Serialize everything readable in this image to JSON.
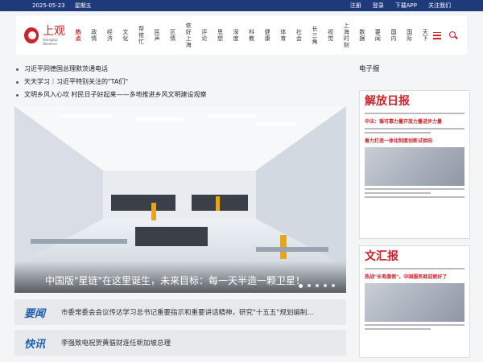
{
  "topbar": {
    "date": "2025-05-23",
    "weekday": "星期五",
    "links": [
      "注册",
      "登录",
      "下载APP",
      "关注我们"
    ]
  },
  "logo": {
    "cn": "上观",
    "en": "Shanghai Observer"
  },
  "nav": [
    "热点",
    "政情",
    "经济",
    "文化",
    "帮侬忙",
    "民声",
    "区情",
    "侬好上海",
    "评论",
    "思想",
    "深度",
    "科教",
    "健康",
    "体育",
    "社会",
    "长三角",
    "视觉",
    "上海时刻",
    "数据",
    "要闻",
    "国内",
    "国际",
    "天下"
  ],
  "news": [
    "习近平同德国总理默茨通电话",
    "天天学习｜习近平特别关注的\"TA们\"",
    "文明乡风入心坎 村民日子好起来——多地推进乡风文明建设观察"
  ],
  "hero": {
    "caption": "中国版\"星链\"在这里诞生，未来目标：每一天半造一颗卫星！"
  },
  "cards": [
    {
      "badge": "要闻",
      "text": "市委常委会会议传达学习总书记重要指示和重要讲话精神，研究\"十五五\"规划编制..."
    },
    {
      "badge": "快讯",
      "text": "李强致电祝贺黄循财连任新加坡总理"
    }
  ],
  "sidebar": {
    "title": "电子报",
    "papers": [
      {
        "mast": "解放日报",
        "headline": "中法：循可靠力量开放力量进步力量",
        "sub": "着力打造一体化制度创新试验田"
      },
      {
        "mast": "文汇报",
        "headline": "热战\"长寿度假\"，中国服务就迎更好了",
        "sub": ""
      }
    ]
  },
  "colors": {
    "brand": "#c8242a",
    "topbar": "#1f3a7a",
    "accent": "#1f5fae"
  }
}
